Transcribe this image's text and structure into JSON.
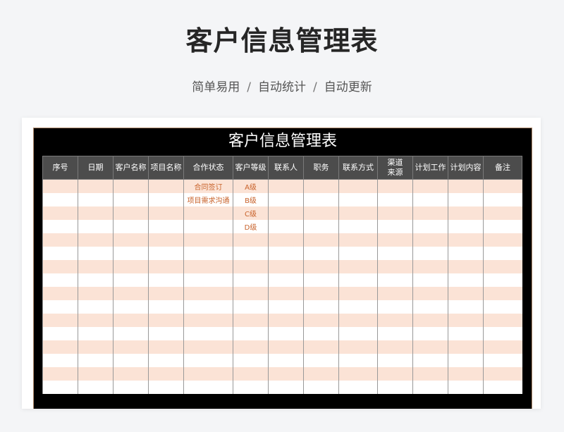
{
  "header": {
    "title": "客户信息管理表",
    "subtitle_items": [
      "简单易用",
      "自动统计",
      "自动更新"
    ],
    "separator": "/"
  },
  "sheet": {
    "title": "客户信息管理表",
    "columns": [
      "序号",
      "日期",
      "客户名称",
      "项目名称",
      "合作状态",
      "客户等级",
      "联系人",
      "职务",
      "联系方式",
      "渠道\n来源",
      "计划工作",
      "计划内容",
      "备注"
    ],
    "rows": [
      [
        "",
        "",
        "",
        "",
        "合同签订",
        "A级",
        "",
        "",
        "",
        "",
        "",
        "",
        ""
      ],
      [
        "",
        "",
        "",
        "",
        "项目需求沟通",
        "B级",
        "",
        "",
        "",
        "",
        "",
        "",
        ""
      ],
      [
        "",
        "",
        "",
        "",
        "",
        "C级",
        "",
        "",
        "",
        "",
        "",
        "",
        ""
      ],
      [
        "",
        "",
        "",
        "",
        "",
        "D级",
        "",
        "",
        "",
        "",
        "",
        "",
        ""
      ],
      [
        "",
        "",
        "",
        "",
        "",
        "",
        "",
        "",
        "",
        "",
        "",
        "",
        ""
      ],
      [
        "",
        "",
        "",
        "",
        "",
        "",
        "",
        "",
        "",
        "",
        "",
        "",
        ""
      ],
      [
        "",
        "",
        "",
        "",
        "",
        "",
        "",
        "",
        "",
        "",
        "",
        "",
        ""
      ],
      [
        "",
        "",
        "",
        "",
        "",
        "",
        "",
        "",
        "",
        "",
        "",
        "",
        ""
      ],
      [
        "",
        "",
        "",
        "",
        "",
        "",
        "",
        "",
        "",
        "",
        "",
        "",
        ""
      ],
      [
        "",
        "",
        "",
        "",
        "",
        "",
        "",
        "",
        "",
        "",
        "",
        "",
        ""
      ],
      [
        "",
        "",
        "",
        "",
        "",
        "",
        "",
        "",
        "",
        "",
        "",
        "",
        ""
      ],
      [
        "",
        "",
        "",
        "",
        "",
        "",
        "",
        "",
        "",
        "",
        "",
        "",
        ""
      ],
      [
        "",
        "",
        "",
        "",
        "",
        "",
        "",
        "",
        "",
        "",
        "",
        "",
        ""
      ],
      [
        "",
        "",
        "",
        "",
        "",
        "",
        "",
        "",
        "",
        "",
        "",
        "",
        ""
      ],
      [
        "",
        "",
        "",
        "",
        "",
        "",
        "",
        "",
        "",
        "",
        "",
        "",
        ""
      ],
      [
        "",
        "",
        "",
        "",
        "",
        "",
        "",
        "",
        "",
        "",
        "",
        "",
        ""
      ]
    ]
  },
  "colors": {
    "header_bg": "#4c4c4c",
    "sheet_bg": "#000000",
    "stripe": "#fbe3d6",
    "accent_text": "#c8622a"
  }
}
